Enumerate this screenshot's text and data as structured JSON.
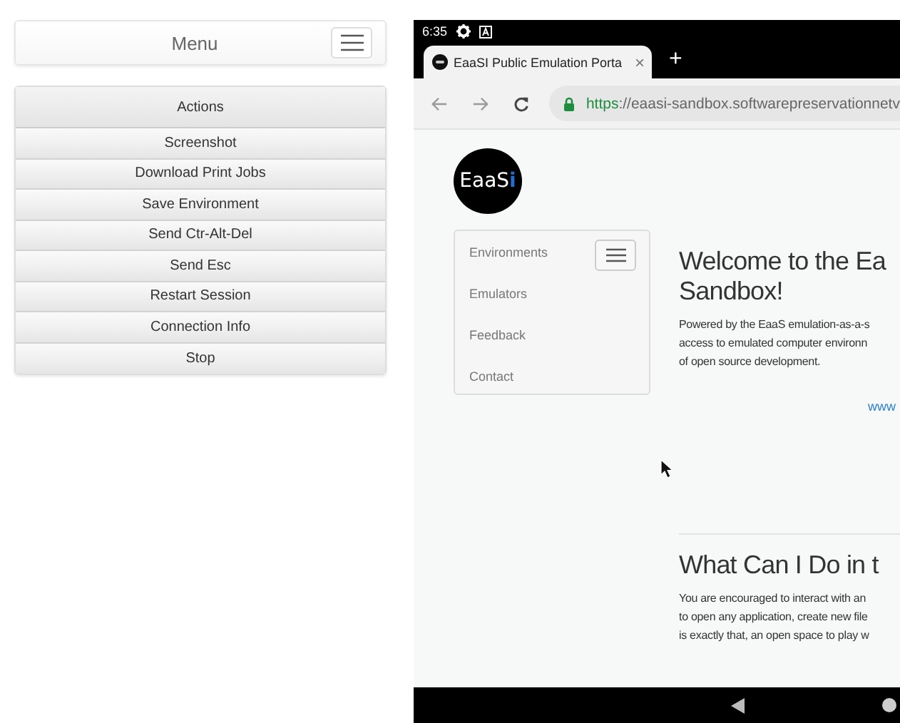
{
  "menu_card": {
    "title": "Menu"
  },
  "actions_panel": {
    "title": "Actions",
    "items": [
      "Screenshot",
      "Download Print Jobs",
      "Save Environment",
      "Send Ctr-Alt-Del",
      "Send Esc",
      "Restart Session",
      "Connection Info",
      "Stop"
    ]
  },
  "emulator": {
    "status_bar": {
      "time": "6:35"
    },
    "browser_tab": {
      "title": "EaaSI Public Emulation Porta",
      "close": "×",
      "new_tab": "+"
    },
    "address_bar": {
      "url_scheme": "https",
      "url_rest": "://eaasi-sandbox.softwarepreservationnetv"
    },
    "page": {
      "logo": {
        "text": "EaaS",
        "accent": "i"
      },
      "sidebar": {
        "items": [
          "Environments",
          "Emulators",
          "Feedback",
          "Contact"
        ]
      },
      "welcome": {
        "heading_lines": [
          "Welcome to the Ea",
          "Sandbox!"
        ],
        "paragraph_lines": [
          "Powered by the EaaS emulation-as-a-s",
          "access to emulated computer environn",
          "of open source development."
        ],
        "link": "www"
      },
      "section": {
        "heading": "What Can I Do in t",
        "paragraph_lines": [
          "You are encouraged to interact with an",
          "to open any application, create new file",
          "is exactly that, an open space to play w"
        ]
      }
    }
  }
}
